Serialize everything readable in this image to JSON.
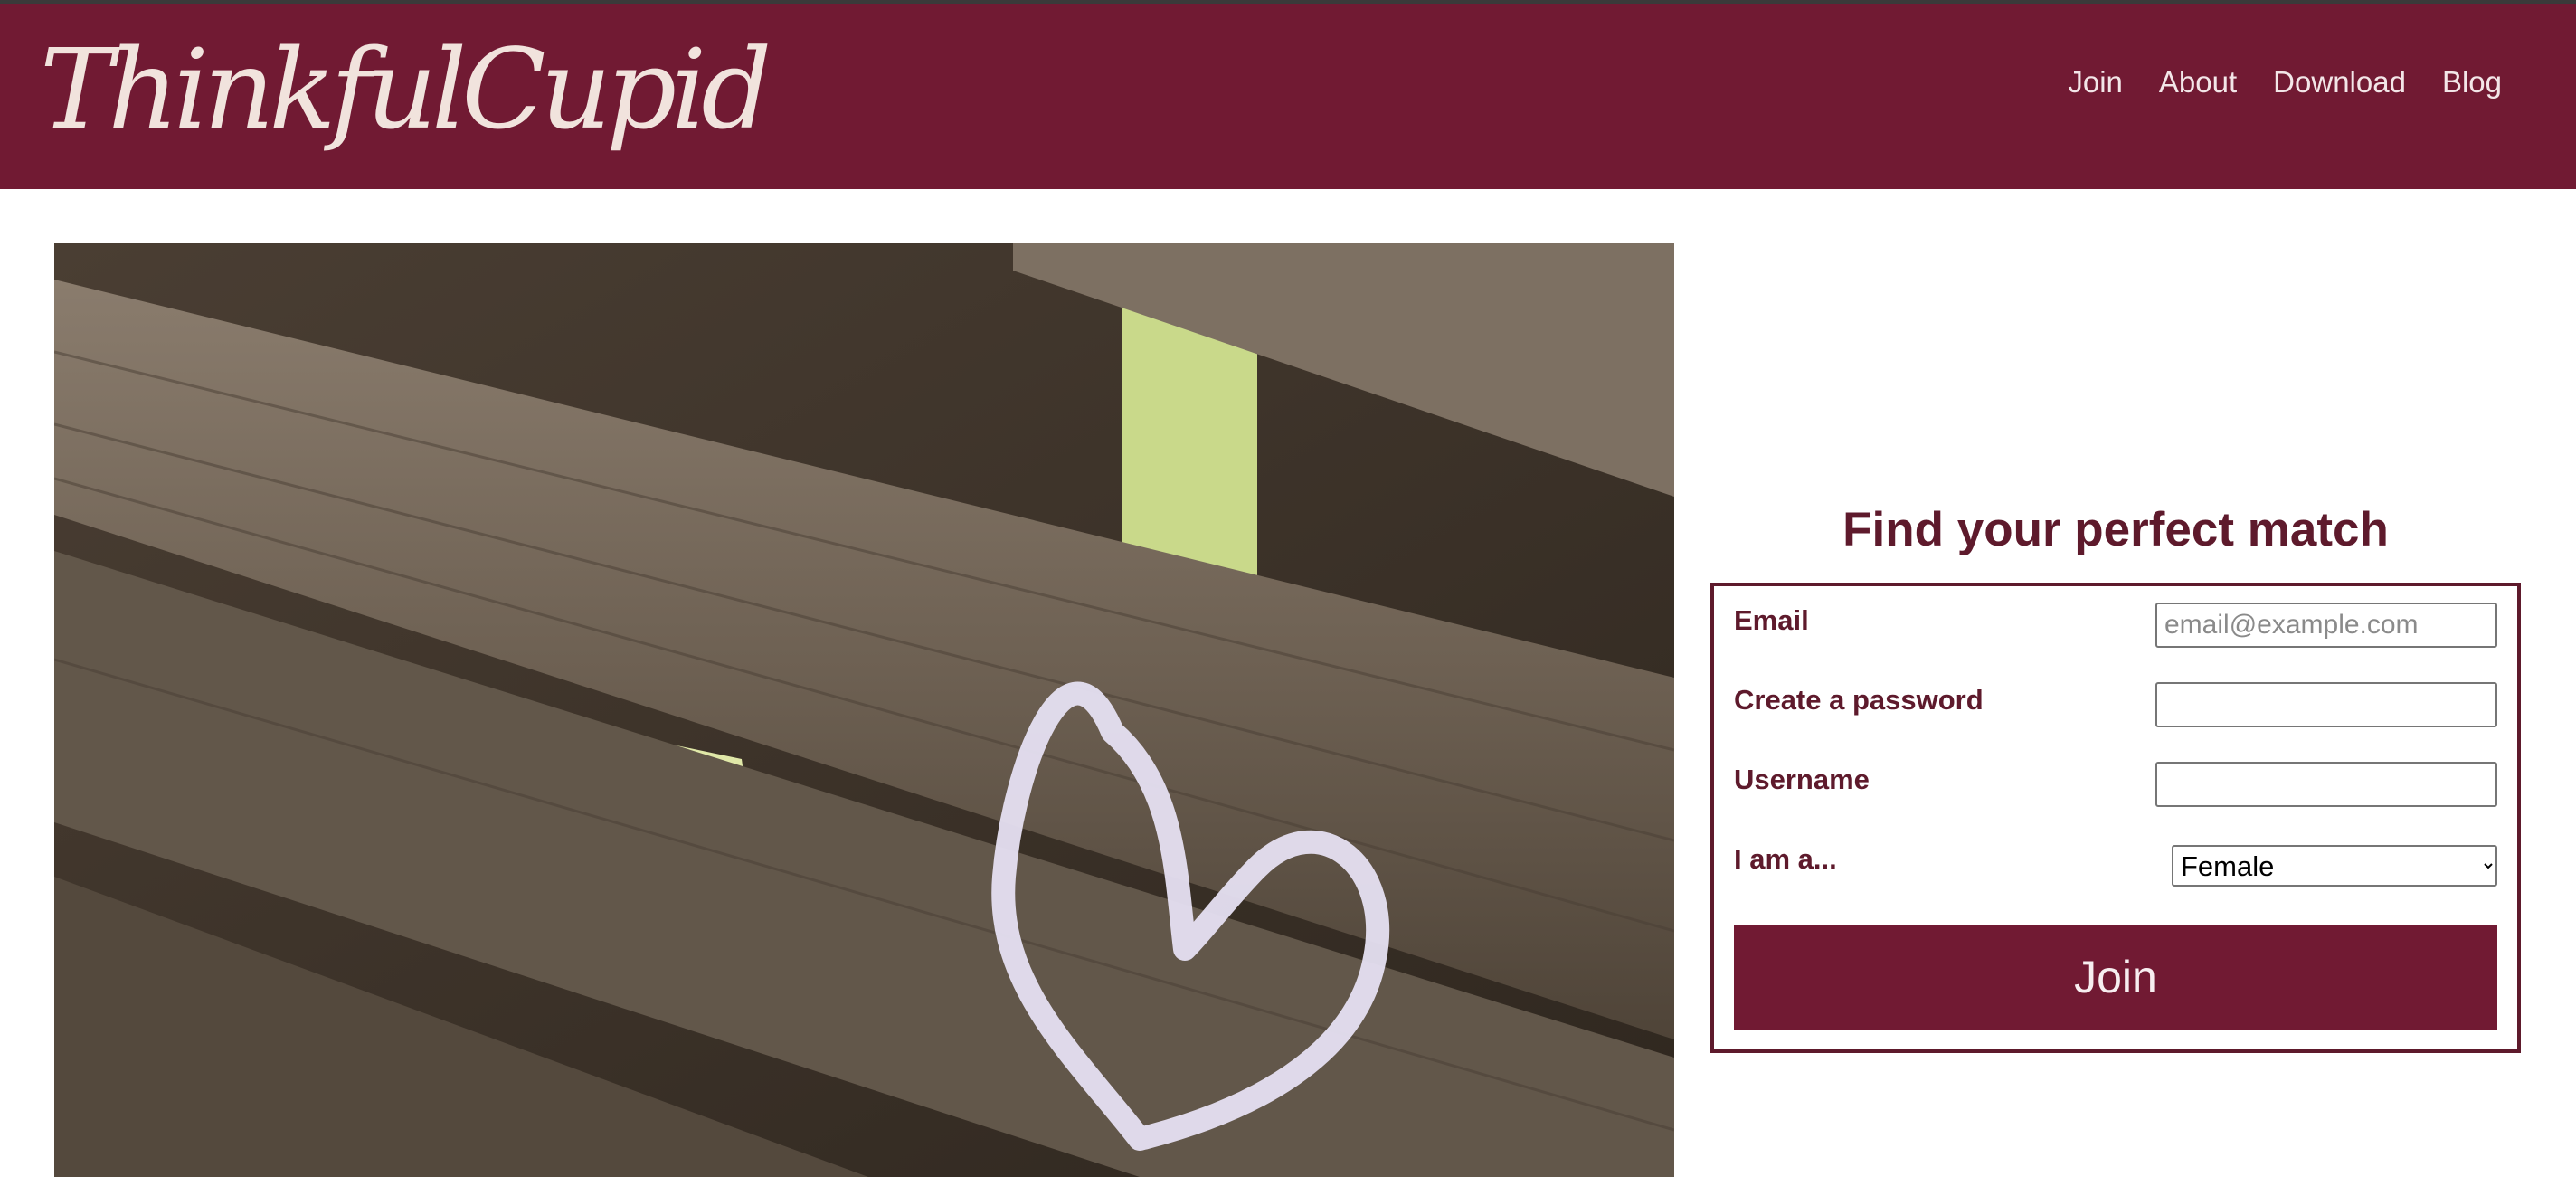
{
  "brand": {
    "logo_text": "ThinkfulCupid",
    "primary_color": "#711a33",
    "text_color": "#5e1a2c"
  },
  "nav": {
    "items": [
      {
        "label": "Join"
      },
      {
        "label": "About"
      },
      {
        "label": "Download"
      },
      {
        "label": "Blog"
      }
    ]
  },
  "hero": {
    "image_subject": "chalk heart on wooden bench"
  },
  "signup": {
    "title": "Find your perfect match",
    "email": {
      "label": "Email",
      "placeholder": "email@example.com",
      "value": ""
    },
    "password": {
      "label": "Create a password",
      "value": ""
    },
    "username": {
      "label": "Username",
      "value": ""
    },
    "gender": {
      "label": "I am a...",
      "selected": "Female"
    },
    "submit_label": "Join"
  }
}
